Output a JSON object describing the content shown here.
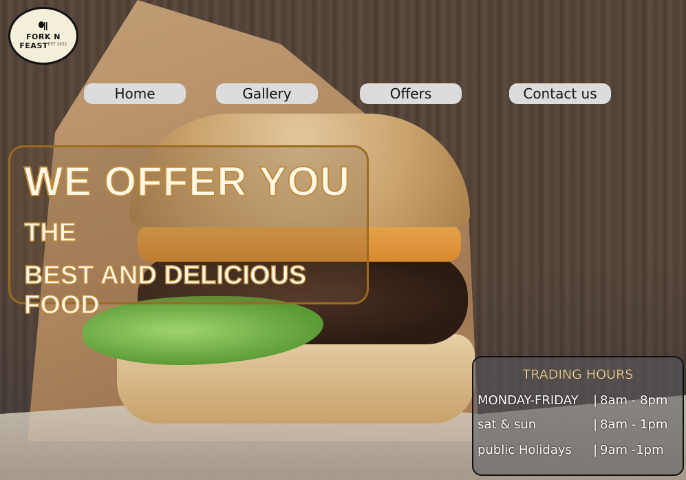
{
  "logo": {
    "line1": "FORK N",
    "line2": "FEAST",
    "since": "EST 2022"
  },
  "nav": {
    "home": "Home",
    "gallery": "Gallery",
    "offers": "Offers",
    "contact": "Contact us"
  },
  "hero": {
    "line1": "WE OFFER YOU",
    "line2": "THE",
    "line3": "BEST AND DELICIOUS FOOD"
  },
  "trading_hours": {
    "title": "TRADING HOURS",
    "rows": [
      {
        "day": "MONDAY-FRIDAY",
        "sep": "|",
        "time": "8am - 8pm"
      },
      {
        "day": "sat & sun",
        "sep": "|",
        "time": "8am - 1pm"
      },
      {
        "day": "public Holidays",
        "sep": "|",
        "time": "9am -1pm"
      }
    ]
  },
  "colors": {
    "nav_bg": "#dcdcdc",
    "hero_border": "#9a6b21",
    "hero_text": "#fff8e6",
    "logo_bg": "#f3efd9"
  }
}
